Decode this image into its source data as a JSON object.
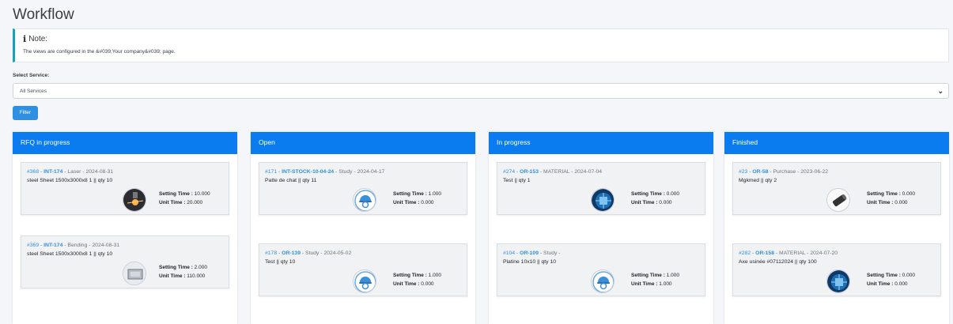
{
  "page": {
    "title": "Workflow"
  },
  "note": {
    "heading": "Note:",
    "text": "The views are configured in the &#039;Your company&#039; page."
  },
  "service": {
    "label": "Select Service:",
    "selected": "All Services"
  },
  "filter_button": "Filter",
  "accent": "#0a7cf0",
  "columns": [
    {
      "title": "RFQ in progress",
      "cards": [
        {
          "num": "#368",
          "ref": "INT-174",
          "op": "Laser",
          "date": "2024-08-31",
          "desc": "steel Sheet 1500x3000x8 1 || qty 10",
          "setting_label": "Setting Time :",
          "setting": "10.000",
          "unit_label": "Unit Time :",
          "unit": "20.000",
          "image": "laser-cut-image"
        },
        {
          "num": "#369",
          "ref": "INT-174",
          "op": "Bending",
          "date": "2024-08-31",
          "desc": "steel Sheet 1500x3000x8 1 || qty 10",
          "setting_label": "Setting Time :",
          "setting": "2.000",
          "unit_label": "Unit Time :",
          "unit": "110.000",
          "image": "bending-machine-image"
        }
      ]
    },
    {
      "title": "Open",
      "cards": [
        {
          "num": "#171",
          "ref": "INT-STOCK-10-04-24",
          "op": "Study",
          "date": "2024-04-17",
          "desc": "Patte de chat || qty 11",
          "setting_label": "Setting Time :",
          "setting": "1.000",
          "unit_label": "Unit Time :",
          "unit": "0.000",
          "image": "engineer-helmet-icon"
        },
        {
          "num": "#178",
          "ref": "OR-139",
          "op": "Study",
          "date": "2024-05-02",
          "desc": "Test || qty 10",
          "setting_label": "Setting Time :",
          "setting": "1.000",
          "unit_label": "Unit Time :",
          "unit": "0.000",
          "image": "engineer-helmet-icon"
        }
      ]
    },
    {
      "title": "In progress",
      "cards": [
        {
          "num": "#274",
          "ref": "OR-153",
          "op": "MATERIAL",
          "date": "2024-07-04",
          "desc": "Test || qty 1",
          "setting_label": "Setting Time :",
          "setting": "0.000",
          "unit_label": "Unit Time :",
          "unit": "0.000",
          "image": "material-chip-image"
        },
        {
          "num": "#104",
          "ref": "OR-109",
          "op": "Study",
          "date": "",
          "desc": "Platine 10x10 || qty 10",
          "setting_label": "Setting Time :",
          "setting": "1.000",
          "unit_label": "Unit Time :",
          "unit": "1.000",
          "image": "engineer-helmet-icon"
        }
      ]
    },
    {
      "title": "Finished",
      "cards": [
        {
          "num": "#23",
          "ref": "OR-58",
          "op": "Purchase",
          "date": "2023-06-22",
          "desc": "Mgkmed || qty 2",
          "setting_label": "Setting Time :",
          "setting": "0.000",
          "unit_label": "Unit Time :",
          "unit": "0.000",
          "image": "part-photo-image"
        },
        {
          "num": "#282",
          "ref": "OR-158",
          "op": "MATERIAL",
          "date": "2024-07-20",
          "desc": "Axe usinée #07112024 || qty 100",
          "setting_label": "Setting Time :",
          "setting": "0.000",
          "unit_label": "Unit Time :",
          "unit": "0.000",
          "image": "material-chip-image"
        }
      ]
    }
  ]
}
